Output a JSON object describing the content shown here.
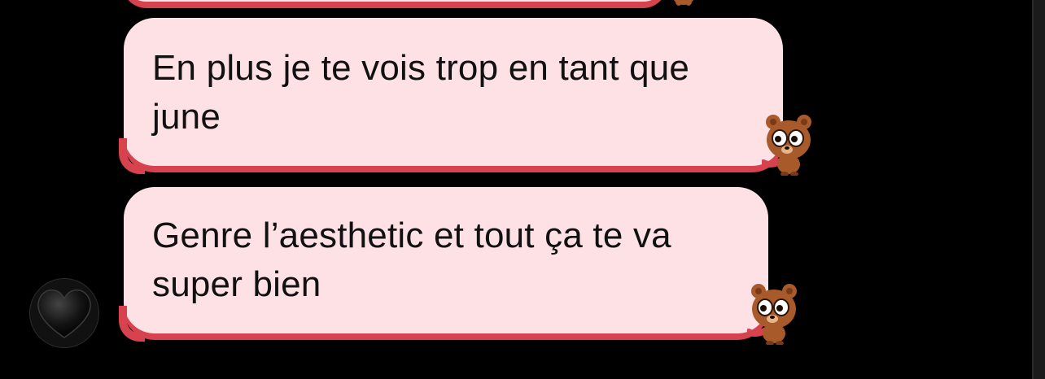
{
  "messages": [
    {
      "text_line1": "En plus je te vois trop en tant que",
      "text_line2": "june"
    },
    {
      "text_line1": "Genre l’aesthetic et tout ça te va",
      "text_line2": "super bien"
    }
  ],
  "colors": {
    "background": "#000000",
    "bubble_fill": "#fde1e5",
    "bubble_border": "#d6434f",
    "bear_fur": "#a85a2a",
    "heart": "#1a1a1a"
  },
  "icons": {
    "bear_sticker": "bear-sticker-icon",
    "avatar": "black-heart-icon"
  }
}
